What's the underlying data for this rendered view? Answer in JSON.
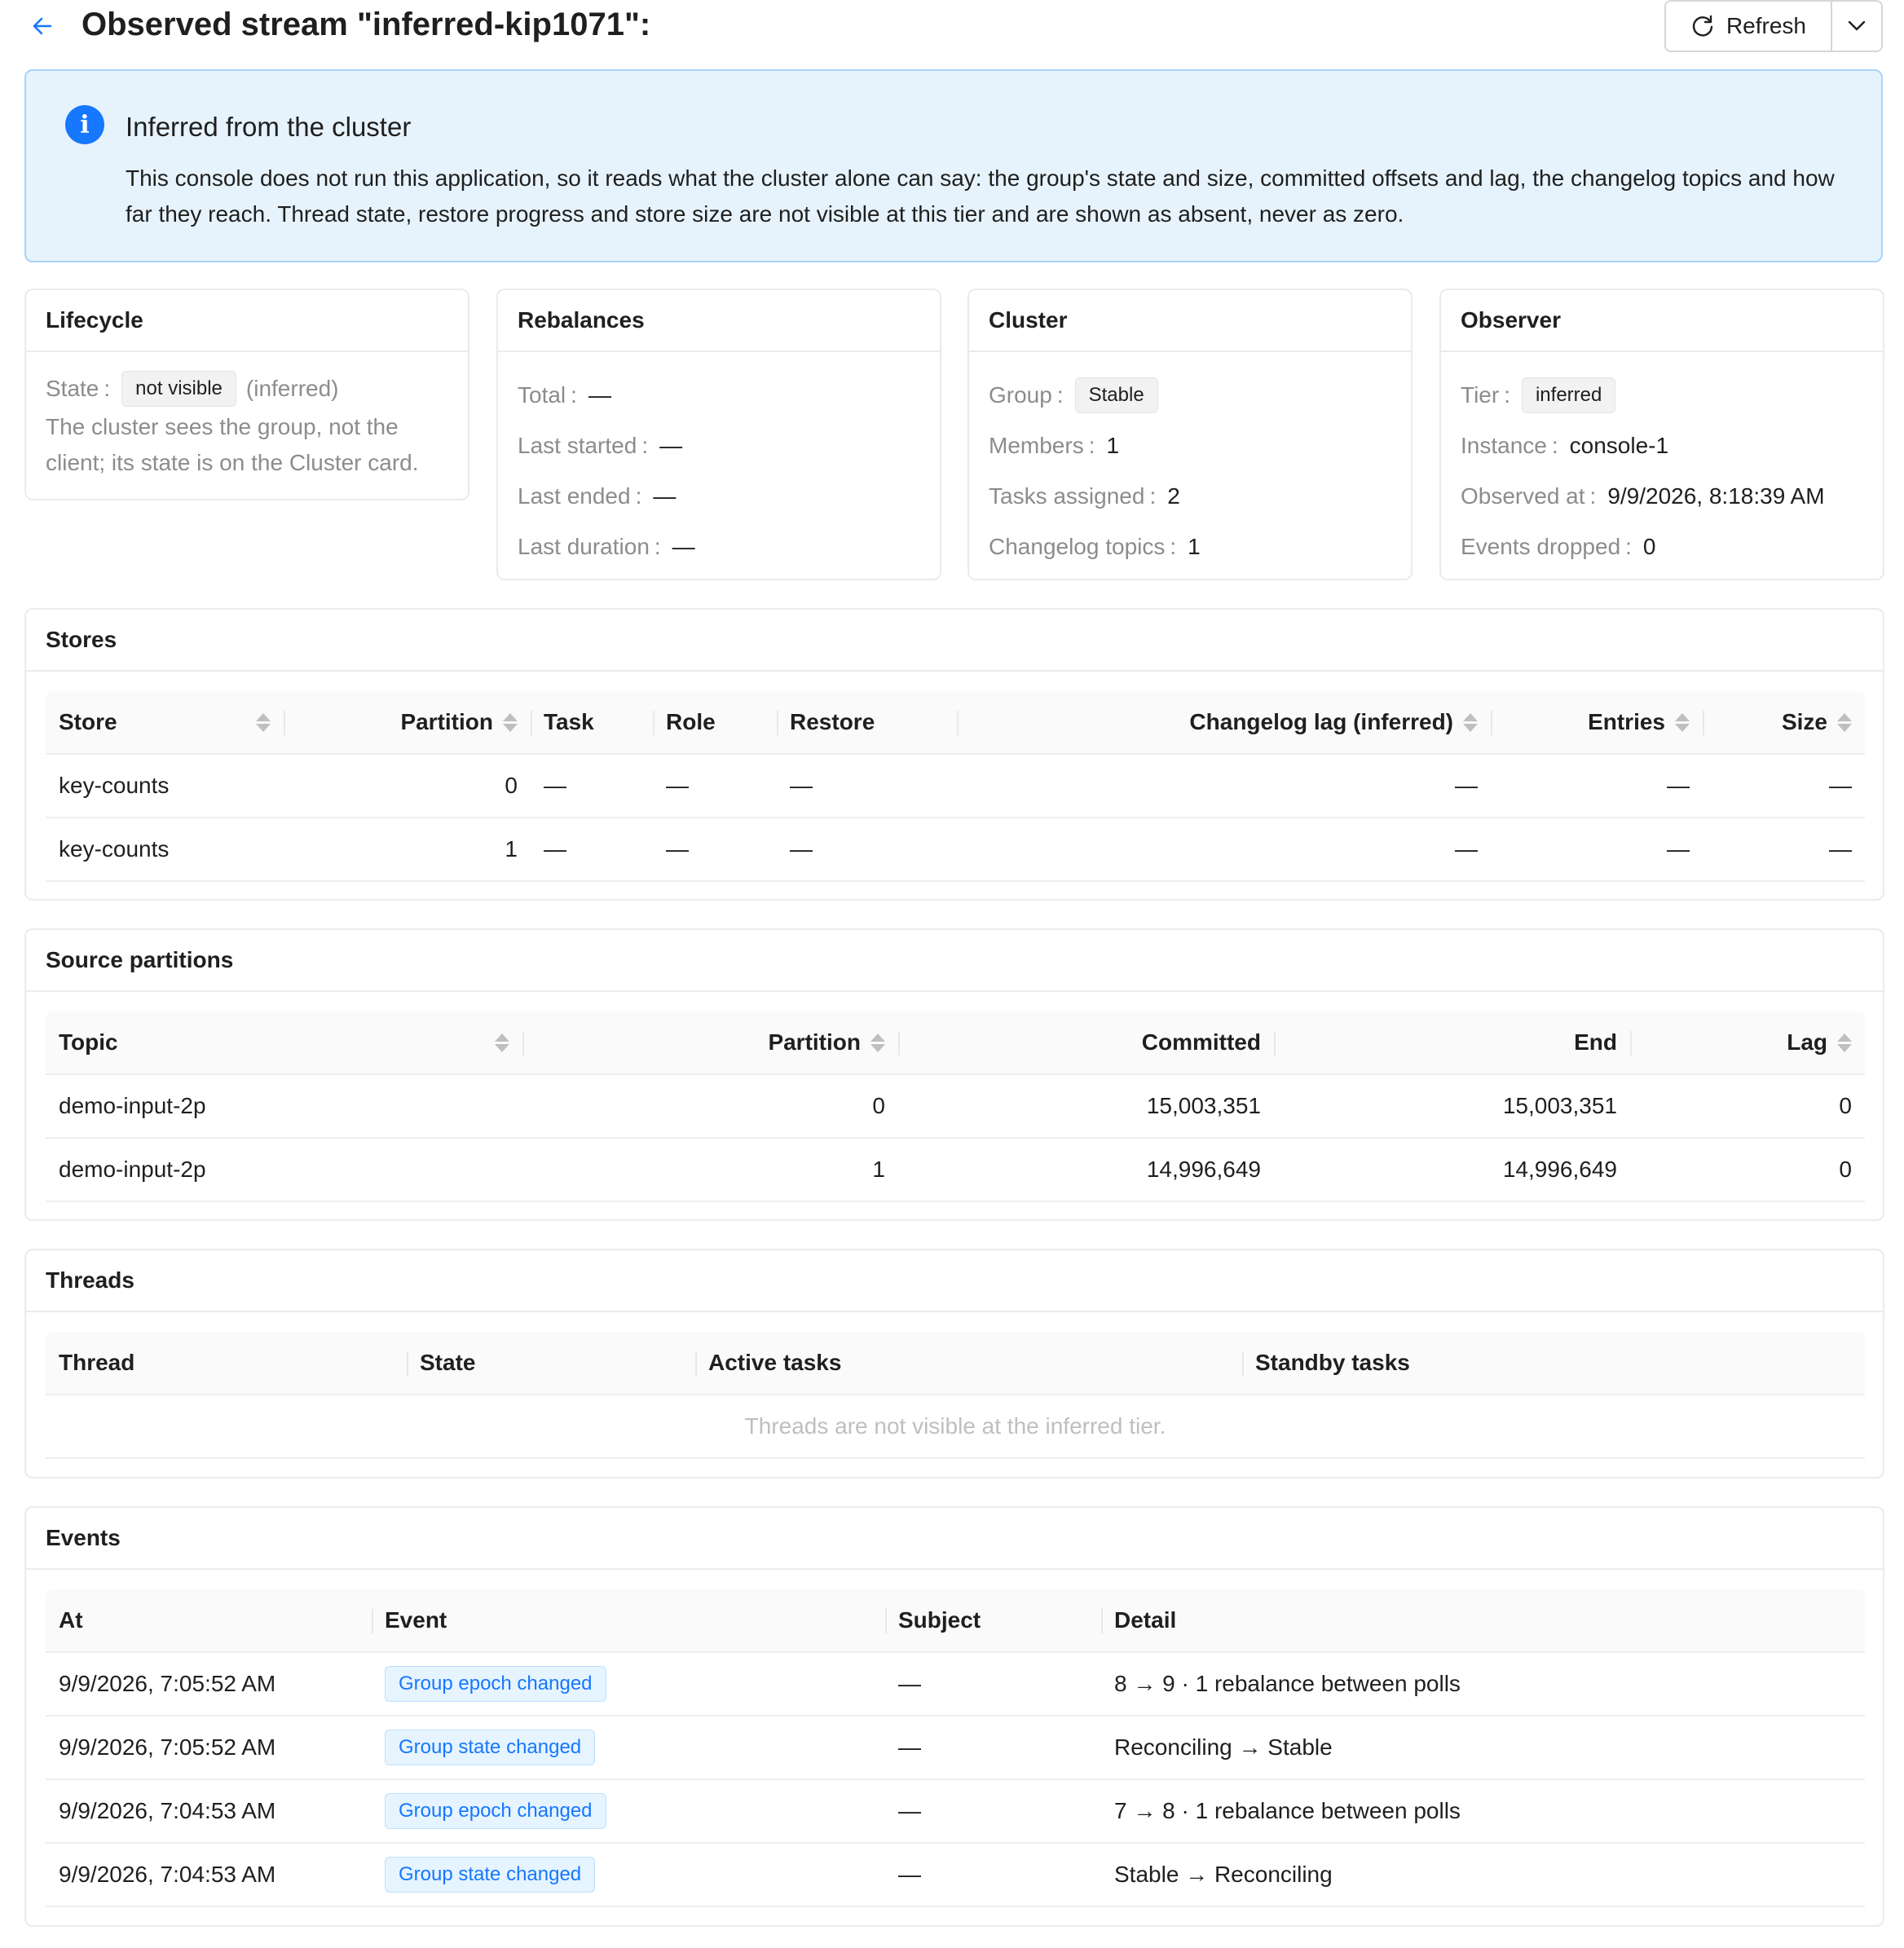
{
  "header": {
    "title": "Observed stream \"inferred-kip1071\":",
    "refresh_label": "Refresh"
  },
  "alert": {
    "title": "Inferred from the cluster",
    "body": "This console does not run this application, so it reads what the cluster alone can say: the group's state and size, committed offsets and lag, the changelog topics and how far they reach. Thread state, restore progress and store size are not visible at this tier and are shown as absent, never as zero."
  },
  "lifecycle": {
    "title": "Lifecycle",
    "state_label": "State",
    "state_value": "not visible",
    "state_suffix": "(inferred)",
    "note": "The cluster sees the group, not the client; its state is on the Cluster card."
  },
  "rebalances": {
    "title": "Rebalances",
    "rows": [
      {
        "label": "Total",
        "value": "—"
      },
      {
        "label": "Last started",
        "value": "—"
      },
      {
        "label": "Last ended",
        "value": "—"
      },
      {
        "label": "Last duration",
        "value": "—"
      }
    ]
  },
  "cluster": {
    "title": "Cluster",
    "group_label": "Group",
    "group_value": "Stable",
    "rows": [
      {
        "label": "Members",
        "value": "1"
      },
      {
        "label": "Tasks assigned",
        "value": "2"
      },
      {
        "label": "Changelog topics",
        "value": "1"
      }
    ]
  },
  "observer": {
    "title": "Observer",
    "tier_label": "Tier",
    "tier_value": "inferred",
    "rows": [
      {
        "label": "Instance",
        "value": "console-1"
      },
      {
        "label": "Observed at",
        "value": "9/9/2026, 8:18:39 AM"
      },
      {
        "label": "Events dropped",
        "value": "0"
      }
    ]
  },
  "stores": {
    "title": "Stores",
    "columns": [
      "Store",
      "Partition",
      "Task",
      "Role",
      "Restore",
      "Changelog lag (inferred)",
      "Entries",
      "Size"
    ],
    "rows": [
      [
        "key-counts",
        "0",
        "—",
        "—",
        "—",
        "—",
        "—",
        "—"
      ],
      [
        "key-counts",
        "1",
        "—",
        "—",
        "—",
        "—",
        "—",
        "—"
      ]
    ]
  },
  "sources": {
    "title": "Source partitions",
    "columns": [
      "Topic",
      "Partition",
      "Committed",
      "End",
      "Lag"
    ],
    "rows": [
      [
        "demo-input-2p",
        "0",
        "15,003,351",
        "15,003,351",
        "0"
      ],
      [
        "demo-input-2p",
        "1",
        "14,996,649",
        "14,996,649",
        "0"
      ]
    ]
  },
  "threads": {
    "title": "Threads",
    "columns": [
      "Thread",
      "State",
      "Active tasks",
      "Standby tasks"
    ],
    "empty": "Threads are not visible at the inferred tier."
  },
  "events": {
    "title": "Events",
    "columns": [
      "At",
      "Event",
      "Subject",
      "Detail"
    ],
    "rows": [
      [
        "9/9/2026, 7:05:52 AM",
        "Group epoch changed",
        "—",
        "8 → 9 · 1 rebalance between polls"
      ],
      [
        "9/9/2026, 7:05:52 AM",
        "Group state changed",
        "—",
        "Reconciling → Stable"
      ],
      [
        "9/9/2026, 7:04:53 AM",
        "Group epoch changed",
        "—",
        "7 → 8 · 1 rebalance between polls"
      ],
      [
        "9/9/2026, 7:04:53 AM",
        "Group state changed",
        "—",
        "Stable → Reconciling"
      ]
    ]
  }
}
